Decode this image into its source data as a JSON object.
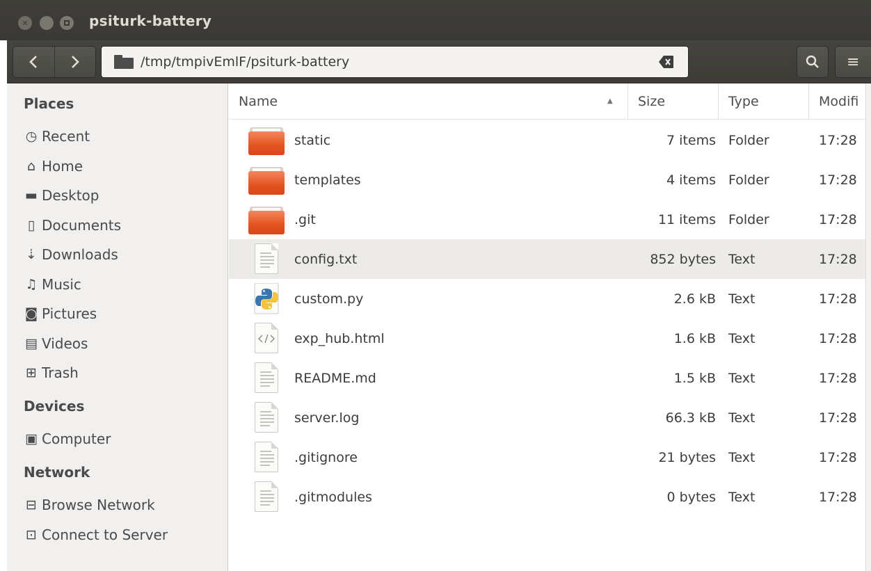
{
  "window": {
    "title": "psiturk-battery"
  },
  "toolbar": {
    "back_label": "<",
    "forward_label": ">",
    "path": "/tmp/tmpivEmlF/psiturk-battery",
    "menu_label": "≡"
  },
  "sidebar": {
    "places_heading": "Places",
    "places": [
      {
        "label": "Recent",
        "icon": "clock-icon",
        "glyph": "◷"
      },
      {
        "label": "Home",
        "icon": "home-icon",
        "glyph": "⌂"
      },
      {
        "label": "Desktop",
        "icon": "desktop-folder-icon",
        "glyph": "▬"
      },
      {
        "label": "Documents",
        "icon": "document-icon",
        "glyph": "▯"
      },
      {
        "label": "Downloads",
        "icon": "download-icon",
        "glyph": "⇣"
      },
      {
        "label": "Music",
        "icon": "music-icon",
        "glyph": "♫"
      },
      {
        "label": "Pictures",
        "icon": "camera-icon",
        "glyph": "◙"
      },
      {
        "label": "Videos",
        "icon": "film-icon",
        "glyph": "▤"
      },
      {
        "label": "Trash",
        "icon": "trash-icon",
        "glyph": "⊞"
      }
    ],
    "devices_heading": "Devices",
    "devices": [
      {
        "label": "Computer",
        "icon": "harddisk-icon",
        "glyph": "▣"
      }
    ],
    "network_heading": "Network",
    "network": [
      {
        "label": "Browse Network",
        "icon": "network-icon",
        "glyph": "⊟"
      },
      {
        "label": "Connect to Server",
        "icon": "server-icon",
        "glyph": "⊡"
      }
    ]
  },
  "columns": {
    "name": "Name",
    "size": "Size",
    "type": "Type",
    "modified": "Modifi"
  },
  "files": [
    {
      "name": "static",
      "size": "7 items",
      "type": "Folder",
      "modified": "17:28",
      "kind": "folder"
    },
    {
      "name": "templates",
      "size": "4 items",
      "type": "Folder",
      "modified": "17:28",
      "kind": "folder"
    },
    {
      "name": ".git",
      "size": "11 items",
      "type": "Folder",
      "modified": "17:28",
      "kind": "folder"
    },
    {
      "name": "config.txt",
      "size": "852 bytes",
      "type": "Text",
      "modified": "17:28",
      "kind": "text",
      "selected": true
    },
    {
      "name": "custom.py",
      "size": "2.6 kB",
      "type": "Text",
      "modified": "17:28",
      "kind": "python"
    },
    {
      "name": "exp_hub.html",
      "size": "1.6 kB",
      "type": "Text",
      "modified": "17:28",
      "kind": "html"
    },
    {
      "name": "README.md",
      "size": "1.5 kB",
      "type": "Text",
      "modified": "17:28",
      "kind": "text"
    },
    {
      "name": "server.log",
      "size": "66.3 kB",
      "type": "Text",
      "modified": "17:28",
      "kind": "text"
    },
    {
      "name": ".gitignore",
      "size": "21 bytes",
      "type": "Text",
      "modified": "17:28",
      "kind": "text"
    },
    {
      "name": ".gitmodules",
      "size": "0 bytes",
      "type": "Text",
      "modified": "17:28",
      "kind": "text"
    }
  ],
  "colors": {
    "titlebar": "#3c3b37",
    "folder_orange": "#e2531f",
    "selected_row": "#ecebe8"
  }
}
